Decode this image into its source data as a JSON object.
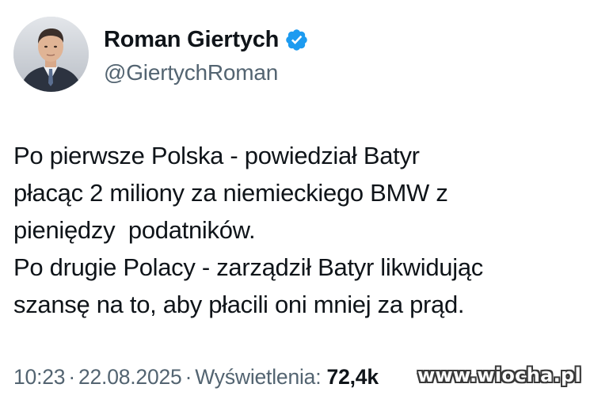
{
  "author": {
    "display_name": "Roman Giertych",
    "handle": "@GiertychRoman",
    "verified": true,
    "avatar_icon": "profile-photo"
  },
  "post": {
    "lines": [
      "Po pierwsze Polska - powiedział Batyr",
      "płacąc 2 miliony za niemieckiego BMW z",
      "pieniędzy  podatników.",
      "Po drugie Polacy - zarządził Batyr likwidując",
      "szansę na to, aby płacili oni mniej za prąd."
    ]
  },
  "meta": {
    "time": "10:23",
    "separator": "·",
    "date": "22.08.2025",
    "views_label": "Wyświetlenia:",
    "views_count": "72,4k"
  },
  "watermark": "www.wiocha.pl",
  "colors": {
    "text_primary": "#0f1419",
    "text_secondary": "#536471",
    "verified_badge": "#1d9bf0"
  }
}
